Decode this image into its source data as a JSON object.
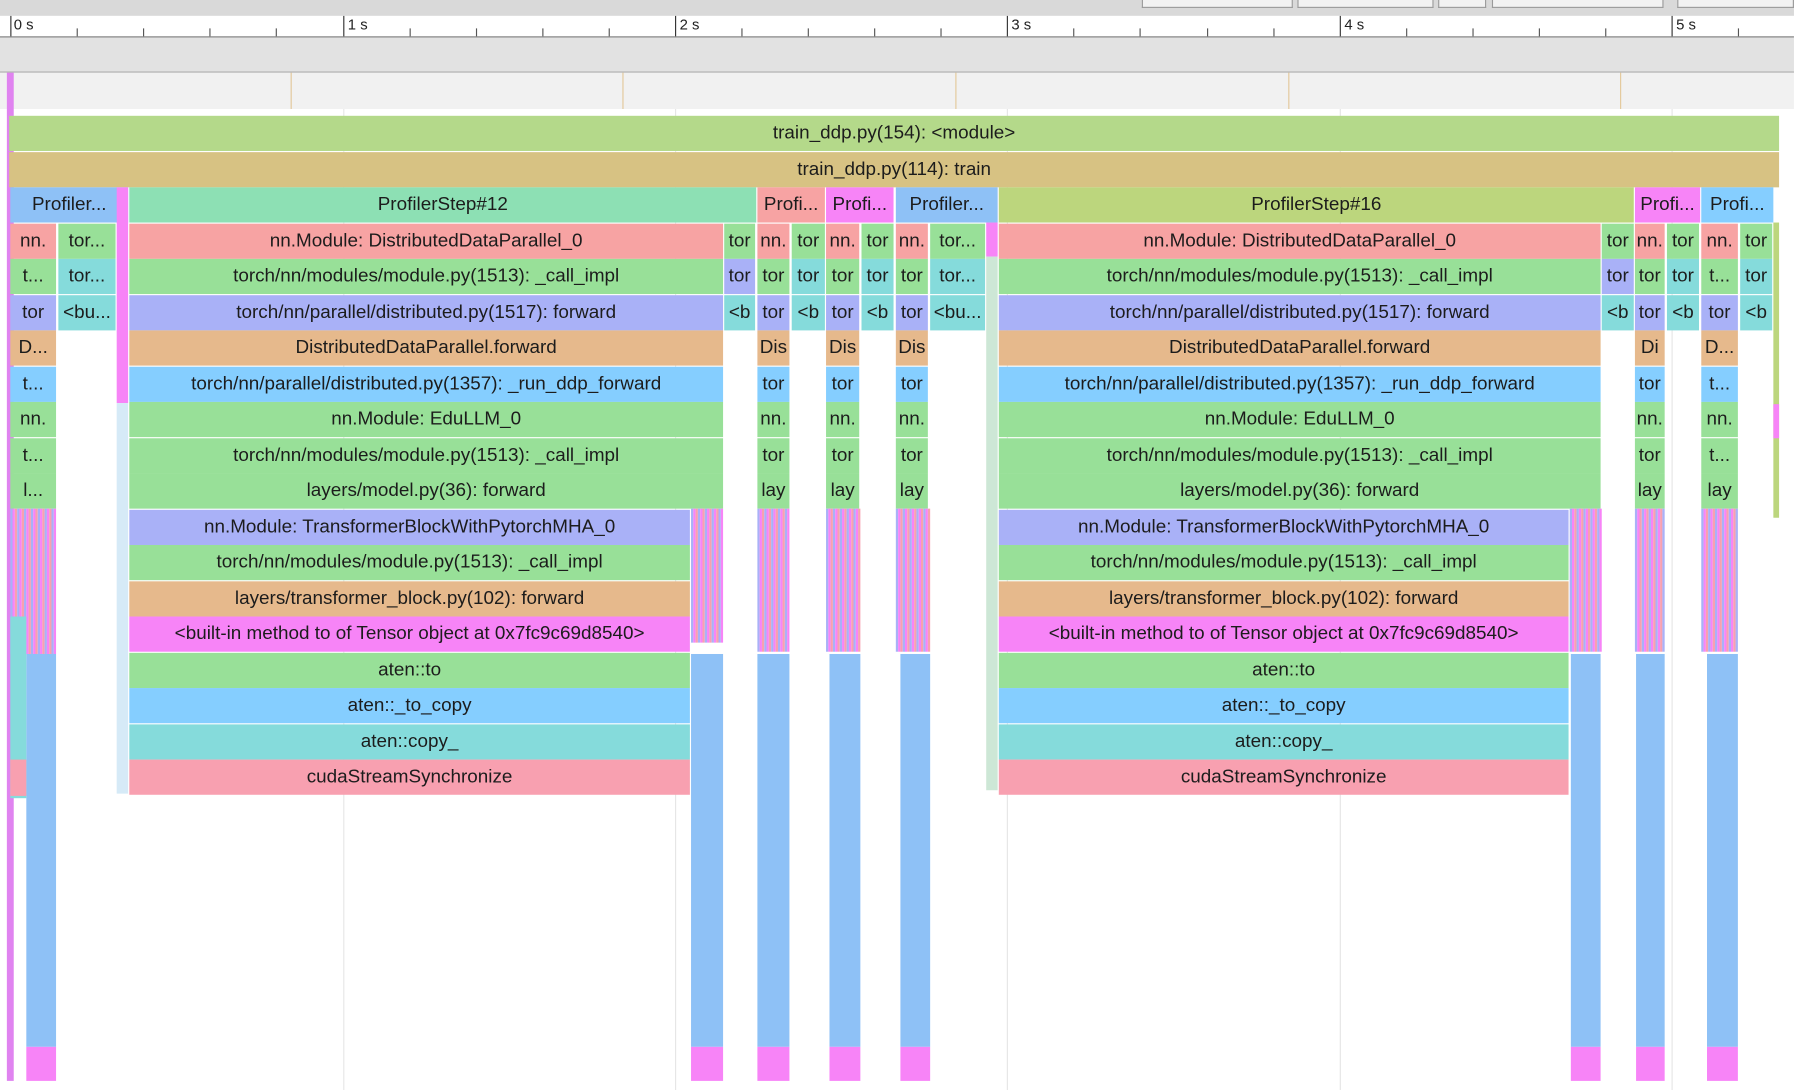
{
  "ruler": {
    "labels": [
      "0 s",
      "1 s",
      "2 s",
      "3 s",
      "4 s",
      "5 s"
    ]
  },
  "frames": {
    "root": "train_ddp.py(154): <module>",
    "train": "train_ddp.py(114): train",
    "step_a_short": "Profiler...",
    "step_12": "ProfilerStep#12",
    "step_b_short": "Profi...",
    "step_c_short": "Profi...",
    "step_d_short": "Profiler...",
    "step_16": "ProfilerStep#16",
    "step_e_short": "Profi...",
    "step_f_short": "Profi...",
    "ddp_module": "nn.Module: DistributedDataParallel_0",
    "call_impl": "torch/nn/modules/module.py(1513): _call_impl",
    "dist_forward": "torch/nn/parallel/distributed.py(1517): forward",
    "ddp_forward": "DistributedDataParallel.forward",
    "run_ddp_forward": "torch/nn/parallel/distributed.py(1357): _run_ddp_forward",
    "edullm": "nn.Module: EduLLM_0",
    "model_forward": "layers/model.py(36): forward",
    "transformer_block": "nn.Module: TransformerBlockWithPytorchMHA_0",
    "tb_forward": "layers/transformer_block.py(102): forward",
    "tensor_to": "<built-in method to of Tensor object at 0x7fc9c69d8540>",
    "aten_to": "aten::to",
    "aten_to_copy": "aten::_to_copy",
    "aten_copy": "aten::copy_",
    "cuda_sync": "cudaStreamSynchronize",
    "short": {
      "nn": "nn.",
      "tor_ellipsis": "tor...",
      "t_ellipsis": "t...",
      "tor": "tor",
      "bu_ellipsis": "<bu...",
      "b": "<b",
      "d_ellipsis": "D...",
      "l_ellipsis": "l...",
      "dis": "Dis",
      "di": "Di",
      "lay": "lay"
    }
  }
}
